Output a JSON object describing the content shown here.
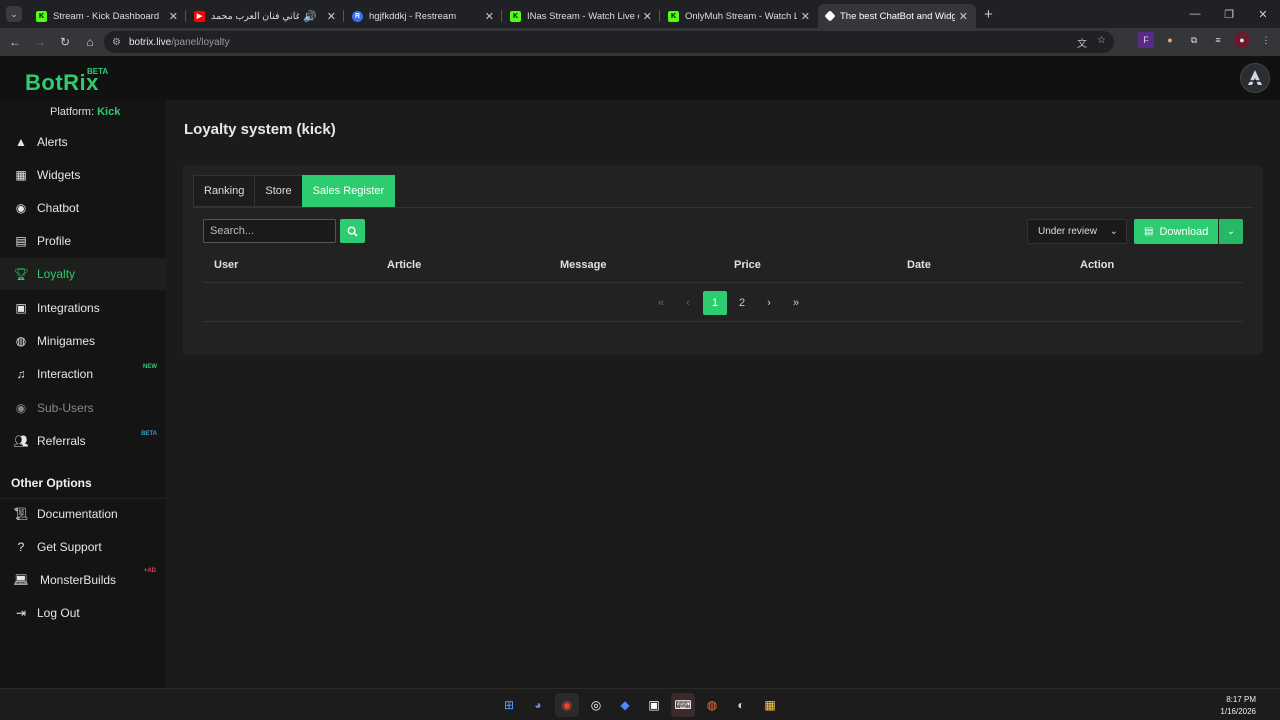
{
  "browser": {
    "tabs": [
      {
        "title": "Stream - Kick Dashboard",
        "favicon": "kick-icon",
        "color": "#53fc18",
        "active": false
      },
      {
        "title": "افضل اغاني فنان العرب محمد",
        "favicon": "youtube-icon",
        "color": "#ff0000",
        "active": false
      },
      {
        "title": "hgjfkddkj - Restream",
        "favicon": "restream-icon",
        "color": "#3a6df0",
        "active": false
      },
      {
        "title": "INas Stream - Watch Live on Kick",
        "favicon": "kick-icon",
        "color": "#53fc18",
        "active": false
      },
      {
        "title": "OnlyMuh Stream - Watch Live on Kick",
        "favicon": "kick-icon",
        "color": "#53fc18",
        "active": false
      },
      {
        "title": "The best ChatBot and Widgets",
        "favicon": "botrix-icon",
        "color": "#ffffff",
        "active": true
      }
    ],
    "url_host": "botrix.live",
    "url_path": "/panel/loyalty"
  },
  "app": {
    "logo": "BotRix",
    "logo_badge": "BETA",
    "platform_label": "Platform:",
    "platform_value": "Kick",
    "accent": "#2ecc71"
  },
  "sidebar": {
    "items": [
      {
        "label": "Alerts",
        "icon": "warning-icon"
      },
      {
        "label": "Widgets",
        "icon": "grid-icon"
      },
      {
        "label": "Chatbot",
        "icon": "robot-icon"
      },
      {
        "label": "Profile",
        "icon": "id-card-icon"
      },
      {
        "label": "Loyalty",
        "icon": "trophy-icon"
      },
      {
        "label": "Integrations",
        "icon": "integrations-icon"
      },
      {
        "label": "Minigames",
        "icon": "gamepad-icon"
      },
      {
        "label": "Interaction",
        "icon": "music-icon",
        "badge": "NEW"
      },
      {
        "label": "Sub-Users",
        "icon": "robot-icon"
      },
      {
        "label": "Referrals",
        "icon": "users-icon",
        "badge": "BETA"
      }
    ],
    "other_title": "Other Options",
    "other_items": [
      {
        "label": "Documentation",
        "icon": "scroll-icon"
      },
      {
        "label": "Get Support",
        "icon": "help-icon"
      },
      {
        "label": "MonsterBuilds",
        "icon": "laptop-icon",
        "badge": "+AD"
      },
      {
        "label": "Log Out",
        "icon": "logout-icon"
      }
    ]
  },
  "main": {
    "title": "Loyalty system (kick)",
    "tabs": [
      "Ranking",
      "Store",
      "Sales Register"
    ],
    "search_placeholder": "Search...",
    "filter_value": "Under review",
    "download_label": "Download",
    "columns": [
      "User",
      "Article",
      "Message",
      "Price",
      "Date",
      "Action"
    ],
    "pagination": {
      "pages": [
        "1",
        "2"
      ],
      "current": "1"
    }
  },
  "taskbar": {
    "time": "8:17 PM",
    "date": "1/16/2026"
  }
}
